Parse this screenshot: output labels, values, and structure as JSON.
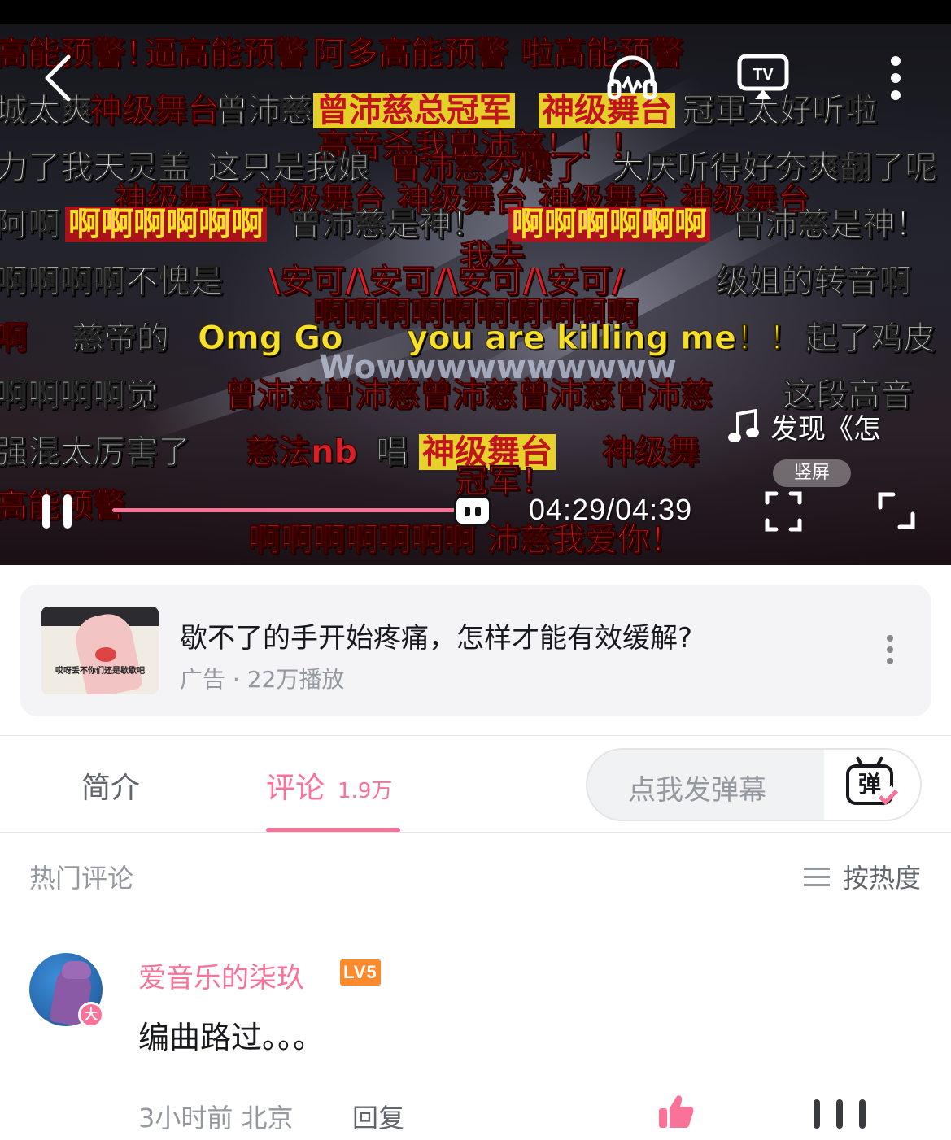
{
  "player": {
    "time": "04:29/04:39",
    "progress_fraction": 0.962,
    "music_label": "发现《怎",
    "portrait_label": "竖屏",
    "danmaku": [
      {
        "text": "高能预警！",
        "style": "red"
      },
      {
        "text": "逼高能预警",
        "style": "red"
      },
      {
        "text": "阿多高能预警",
        "style": "red"
      },
      {
        "text": "啦高能预警",
        "style": "red"
      },
      {
        "text": "城太爽",
        "style": "white"
      },
      {
        "text": "神级舞台",
        "style": "red"
      },
      {
        "text": "曾沛慈",
        "style": "white"
      },
      {
        "text": "曾沛慈总冠军",
        "style": "hl-yellow"
      },
      {
        "text": "神级舞台",
        "style": "hl-yellow"
      },
      {
        "text": "冠軍太好听啦",
        "style": "white"
      },
      {
        "text": "高音杀我曾沛慈！！！",
        "style": "red"
      },
      {
        "text": "力了我天灵盖",
        "style": "white"
      },
      {
        "text": "这只是我娘",
        "style": "white"
      },
      {
        "text": "曾沛慈夯爆了",
        "style": "red"
      },
      {
        "text": "大厌听得好夯爽翻了呢",
        "style": "white"
      },
      {
        "text": "神级舞台 神级舞台 神级舞台 神级舞台 神级舞台",
        "style": "red"
      },
      {
        "text": "阿啊",
        "style": "white"
      },
      {
        "text": "啊啊啊啊啊啊",
        "style": "hl-red"
      },
      {
        "text": "曾沛慈是神！",
        "style": "white"
      },
      {
        "text": "啊啊啊啊啊啊",
        "style": "hl-red"
      },
      {
        "text": "曾沛慈是神！",
        "style": "white"
      },
      {
        "text": "我去",
        "style": "red"
      },
      {
        "text": "啊啊啊啊不愧是",
        "style": "white"
      },
      {
        "text": "\\安可/\\安可/\\安可/\\安可/",
        "style": "red"
      },
      {
        "text": "级姐的转音啊",
        "style": "white"
      },
      {
        "text": "啊啊啊啊啊啊啊啊啊啊",
        "style": "red"
      },
      {
        "text": "啊",
        "style": "red"
      },
      {
        "text": "慈帝的",
        "style": "white"
      },
      {
        "text": "Omg Go",
        "style": "yellow"
      },
      {
        "text": "you are killing me！！",
        "style": "yellow"
      },
      {
        "text": "起了鸡皮",
        "style": "white"
      },
      {
        "text": "Wowwwwwwwwww",
        "style": "grey"
      },
      {
        "text": "啊啊啊啊觉",
        "style": "white"
      },
      {
        "text": "曾沛慈曾沛慈曾沛慈曾沛慈曾沛慈",
        "style": "red"
      },
      {
        "text": "这段高音",
        "style": "white"
      },
      {
        "text": "强混太厉害了",
        "style": "white"
      },
      {
        "text": "慈法nb",
        "style": "red"
      },
      {
        "text": "唱",
        "style": "white"
      },
      {
        "text": "神级舞台",
        "style": "hl-yellow"
      },
      {
        "text": "神级舞",
        "style": "red"
      },
      {
        "text": "冠军！",
        "style": "red"
      },
      {
        "text": "高能预警",
        "style": "red"
      },
      {
        "text": "啊啊啊啊啊啊啊 沛慈我爱你！",
        "style": "red"
      }
    ]
  },
  "ad": {
    "title": "歇不了的手开始疼痛，怎样才能有效缓解?",
    "meta": "广告 · 22万播放",
    "thumb_caption": "哎呀丢不你们还是歇歇吧"
  },
  "tabs": {
    "intro_label": "简介",
    "comment_label": "评论",
    "comment_count": "1.9万"
  },
  "danmu_input": {
    "placeholder": "点我发弹幕",
    "icon_text": "弹"
  },
  "comments_header": {
    "title": "热门评论",
    "sort_label": "按热度"
  },
  "comment": {
    "username": "爱音乐的柒玖",
    "level": "LV5",
    "badge": "大",
    "text": "编曲路过。。。",
    "meta": "3小时前 北京",
    "reply_label": "回复"
  },
  "colors": {
    "accent": "#fb7299",
    "level_badge": "#ff8a2b",
    "danmaku_red": "#d8202a",
    "danmaku_yellow": "#f6e02a"
  }
}
